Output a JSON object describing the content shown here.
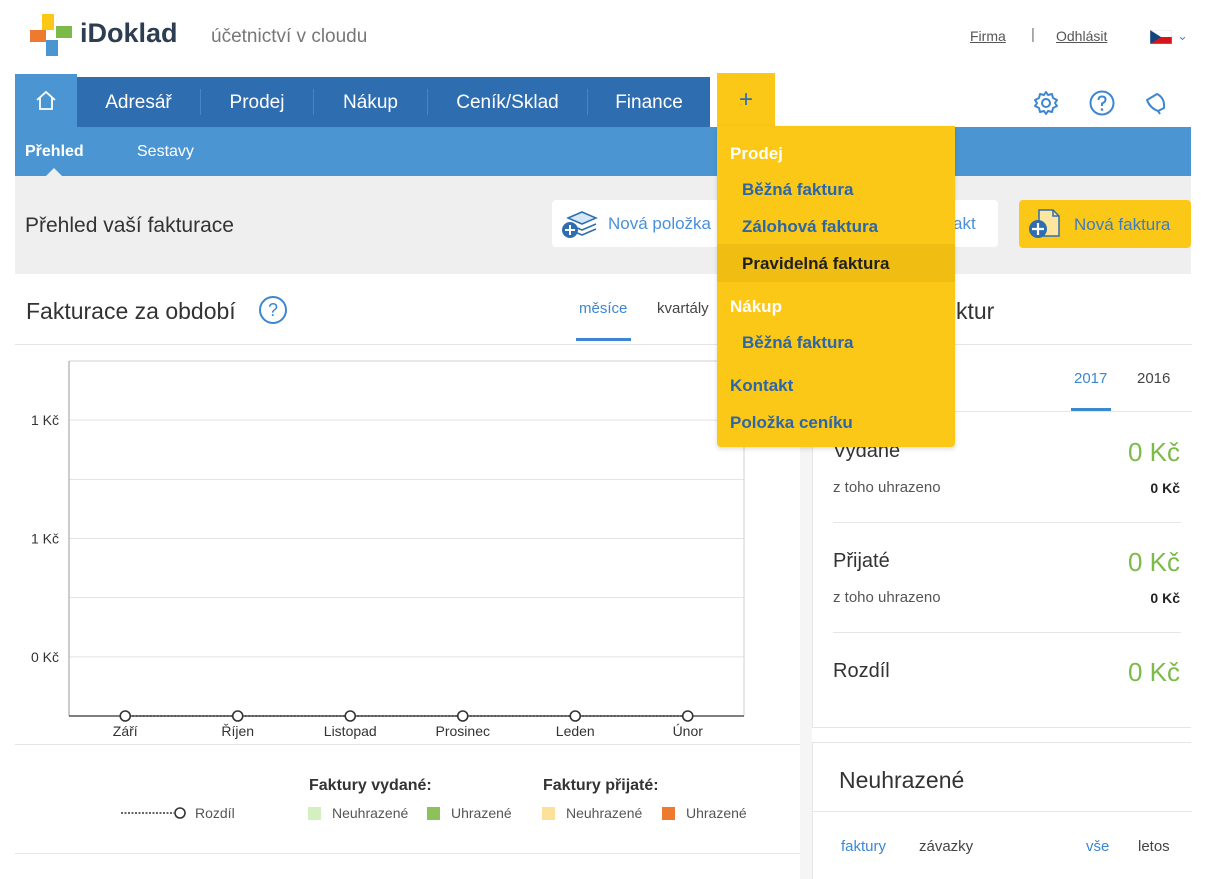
{
  "header": {
    "brand": "iDoklad",
    "tagline": "účetnictví v cloudu",
    "link_firma": "Firma",
    "separator": "|",
    "link_logout": "Odhlásit",
    "language": "cs"
  },
  "nav": {
    "items": [
      "Adresář",
      "Prodej",
      "Nákup",
      "Ceník/Sklad",
      "Finance"
    ],
    "plus": "+"
  },
  "subnav": {
    "items": [
      "Přehled",
      "Sestavy"
    ]
  },
  "overview": {
    "title": "Přehled vaší fakturace",
    "btn_new_item": "Nová položka",
    "btn_contact_partial": "akt",
    "btn_new_invoice": "Nová faktura"
  },
  "chart_panel": {
    "title": "Fakturace za období",
    "help": "?",
    "tabs": [
      "měsíce",
      "kvartály"
    ],
    "active_tab": "měsíce"
  },
  "chart_data": {
    "type": "line",
    "categories": [
      "Září",
      "Říjen",
      "Listopad",
      "Prosinec",
      "Leden",
      "Únor"
    ],
    "y_tick_labels": [
      "1 Kč",
      "1 Kč",
      "0 Kč"
    ],
    "series": [
      {
        "name": "Rozdíl",
        "values": [
          0,
          0,
          0,
          0,
          0,
          0
        ]
      }
    ],
    "grid": true
  },
  "legend": {
    "rozdil": "Rozdíl",
    "issued_title": "Faktury vydané:",
    "received_title": "Faktury přijaté:",
    "unpaid": "Neuhrazené",
    "paid": "Uhrazené",
    "colors": {
      "issued_unpaid": "#d5f0c0",
      "issued_paid": "#8dc15a",
      "received_unpaid": "#fde19a",
      "received_paid": "#ee7a30"
    }
  },
  "summary": {
    "title_partial": "ktur",
    "years": [
      "2017",
      "2016"
    ],
    "active_year": "2017",
    "issued_label": "Vydané",
    "issued_value": "0 Kč",
    "paid_of_label": "z toho uhrazeno",
    "issued_paid_value": "0 Kč",
    "received_label": "Přijaté",
    "received_value": "0 Kč",
    "received_paid_value": "0 Kč",
    "diff_label": "Rozdíl",
    "diff_value": "0 Kč"
  },
  "unpaid_panel": {
    "title": "Neuhrazené",
    "tabs": [
      "faktury",
      "závazky"
    ],
    "filters": [
      "vše",
      "letos"
    ]
  },
  "dropdown": {
    "sales_head": "Prodej",
    "sales_items": [
      "Běžná faktura",
      "Zálohová faktura",
      "Pravidelná faktura"
    ],
    "purchase_head": "Nákup",
    "purchase_items": [
      "Běžná faktura"
    ],
    "contact": "Kontakt",
    "price_item": "Položka ceníku"
  }
}
